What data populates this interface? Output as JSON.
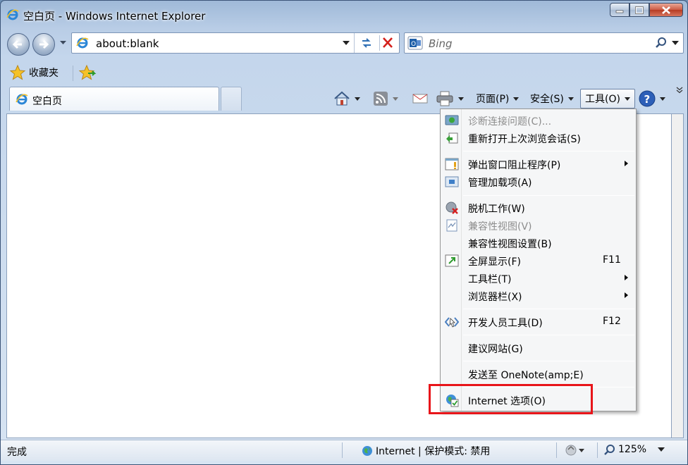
{
  "window": {
    "title": "空白页 - Windows Internet Explorer"
  },
  "address_bar": {
    "url": "about:blank"
  },
  "search": {
    "provider": "Bing"
  },
  "favorites": {
    "label": "收藏夹"
  },
  "tabs": [
    {
      "label": "空白页",
      "active": true
    }
  ],
  "command_bar": {
    "page": "页面(P)",
    "safety": "安全(S)",
    "tools": "工具(O)"
  },
  "tools_menu": {
    "items": [
      {
        "label": "诊断连接问题(C)...",
        "disabled": true,
        "icon": "diagnose-icon"
      },
      {
        "label": "重新打开上次浏览会话(S)",
        "icon": "reopen-session-icon"
      },
      {
        "label": "弹出窗口阻止程序(P)",
        "submenu": true,
        "icon": "popup-blocker-icon"
      },
      {
        "label": "管理加载项(A)",
        "icon": "addons-icon"
      },
      {
        "label": "脱机工作(W)",
        "icon": "offline-icon"
      },
      {
        "label": "兼容性视图(V)",
        "disabled": true,
        "icon": "compat-view-icon"
      },
      {
        "label": "兼容性视图设置(B)"
      },
      {
        "label": "全屏显示(F)",
        "shortcut": "F11",
        "icon": "fullscreen-icon"
      },
      {
        "label": "工具栏(T)",
        "submenu": true
      },
      {
        "label": "浏览器栏(X)",
        "submenu": true
      },
      {
        "label": "开发人员工具(D)",
        "shortcut": "F12",
        "icon": "dev-tools-icon"
      },
      {
        "label": "建议网站(G)"
      },
      {
        "label": "发送至 OneNote(amp;E)"
      },
      {
        "label": "Internet 选项(O)",
        "icon": "internet-options-icon",
        "highlighted": true
      }
    ]
  },
  "status_bar": {
    "status": "完成",
    "zone": "Internet | 保护模式: 禁用",
    "zoom": "125%"
  },
  "colors": {
    "highlight_box": "#e8151a",
    "menu_bg": "#f5f6f7"
  }
}
